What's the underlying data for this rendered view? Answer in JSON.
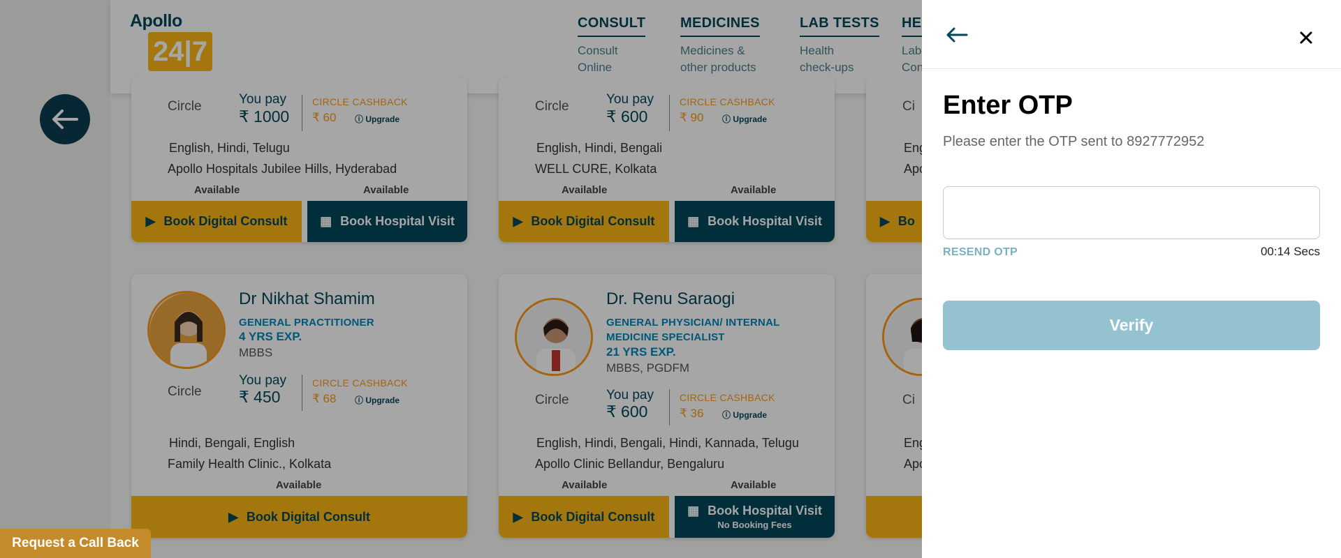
{
  "logo": {
    "top": "Apollo",
    "box": "24|7"
  },
  "nav": [
    {
      "title": "CONSULT",
      "line1": "Consult",
      "line2": "Online"
    },
    {
      "title": "MEDICINES",
      "line1": "Medicines &",
      "line2": "other products"
    },
    {
      "title": "LAB TESTS",
      "line1": "Health",
      "line2": "check-ups"
    },
    {
      "title": "HEA",
      "line1": "Lab",
      "line2": "Con"
    }
  ],
  "cards": [
    {
      "pay_label": "You pay",
      "pay": "₹ 1000",
      "cashback_label": "CIRCLE CASHBACK",
      "cashback": "₹ 60",
      "upgrade": "Upgrade",
      "circle": "Circle",
      "languages": "English, Hindi, Telugu",
      "location": "Apollo Hospitals Jubilee Hills, Hyderabad",
      "avail1": "Available",
      "avail2": "Available",
      "btn_digital": "Book Digital Consult",
      "btn_hospital": "Book Hospital Visit"
    },
    {
      "pay_label": "You pay",
      "pay": "₹ 600",
      "cashback_label": "CIRCLE CASHBACK",
      "cashback": "₹ 90",
      "upgrade": "Upgrade",
      "circle": "Circle",
      "languages": "English, Hindi, Bengali",
      "location": "WELL CURE, Kolkata",
      "avail1": "Available",
      "avail2": "Available",
      "btn_digital": "Book Digital Consult",
      "btn_hospital": "Book Hospital Visit"
    },
    {
      "name": "Dr Nikhat Shamim",
      "spec1": "GENERAL PRACTITIONER",
      "exp": "4 YRS EXP.",
      "degree": "MBBS",
      "pay_label": "You pay",
      "pay": "₹ 450",
      "cashback_label": "CIRCLE CASHBACK",
      "cashback": "₹ 68",
      "upgrade": "Upgrade",
      "circle": "Circle",
      "languages": "Hindi, Bengali, English",
      "location": "Family Health Clinic., Kolkata",
      "avail1": "Available",
      "btn_digital": "Book Digital Consult"
    },
    {
      "name": "Dr. Renu Saraogi",
      "spec1": "GENERAL PHYSICIAN/ INTERNAL",
      "spec2": "MEDICINE SPECIALIST",
      "exp": "21 YRS EXP.",
      "degree": "MBBS, PGDFM",
      "pay_label": "You pay",
      "pay": "₹ 600",
      "cashback_label": "CIRCLE CASHBACK",
      "cashback": "₹ 36",
      "upgrade": "Upgrade",
      "circle": "Circle",
      "languages": "English, Hindi, Bengali, Hindi, Kannada, Telugu",
      "location": "Apollo Clinic Bellandur, Bengaluru",
      "avail1": "Available",
      "avail2": "Available",
      "btn_digital": "Book Digital Consult",
      "btn_hospital": "Book Hospital Visit",
      "btn_hospital_sub": "No Booking Fees"
    }
  ],
  "partial": {
    "lang": "Eng",
    "loc": "Apo",
    "btn": "Bo",
    "circle": "Ci"
  },
  "callback": "Request a Call Back",
  "otp": {
    "title": "Enter OTP",
    "subtitle": "Please enter the OTP sent to 8927772952",
    "input_value": "",
    "resend": "RESEND OTP",
    "timer": "00:14 Secs",
    "verify": "Verify"
  }
}
